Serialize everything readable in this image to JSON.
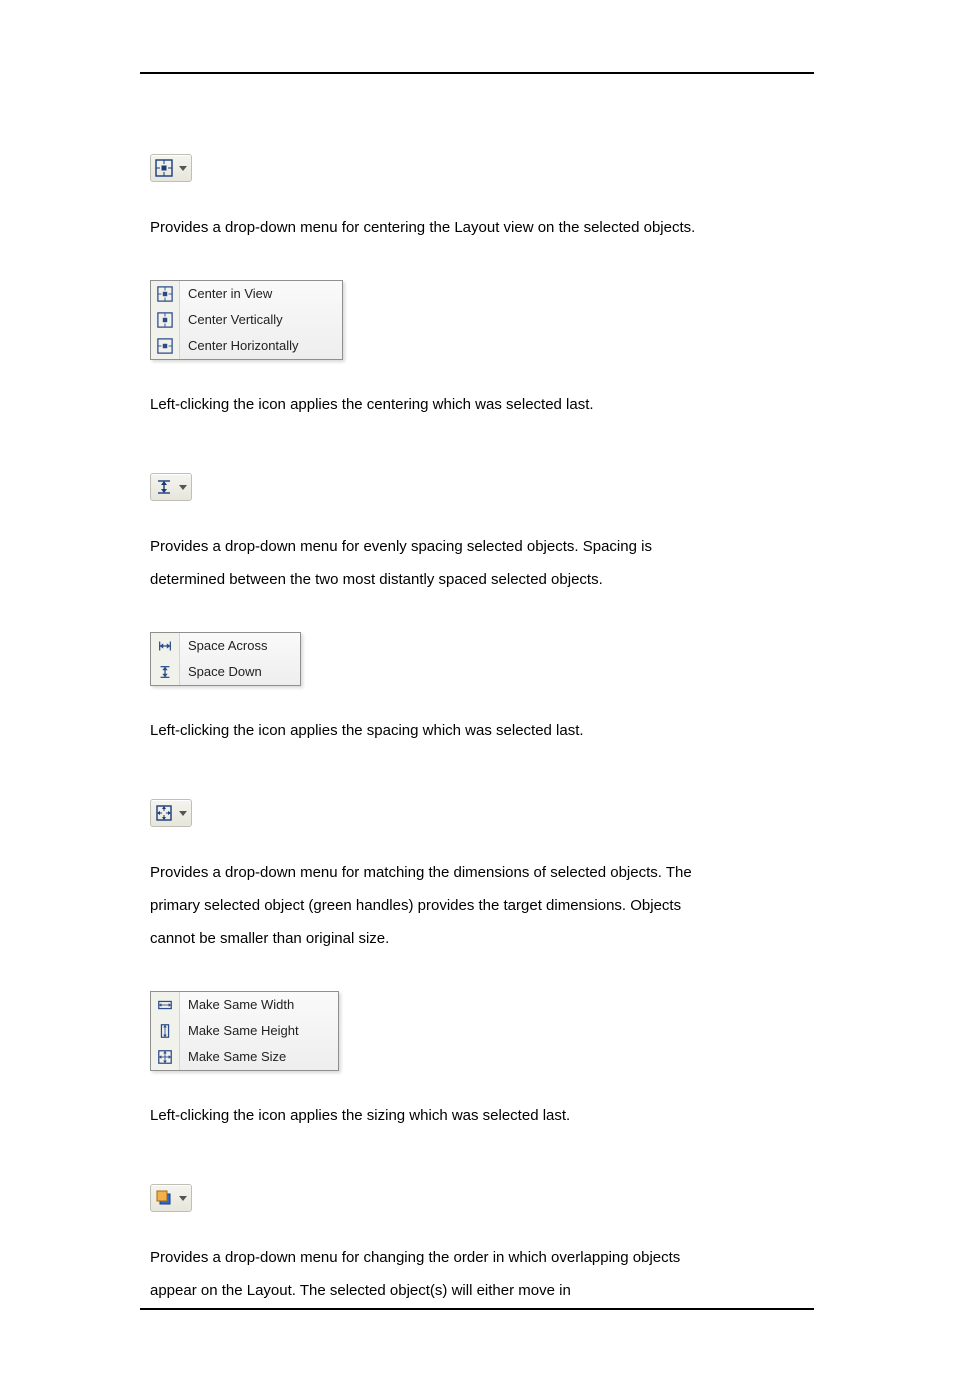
{
  "sections": [
    {
      "para1": "Provides a drop-down menu for centering the Layout view on the selected objects.",
      "para2": "Left-clicking the icon applies the centering which was selected last.",
      "menu": [
        {
          "label": "Center in View"
        },
        {
          "label": "Center Vertically"
        },
        {
          "label": "Center Horizontally"
        }
      ]
    },
    {
      "para1": "Provides a drop-down menu for evenly spacing selected objects. Spacing is determined between the two most distantly spaced selected objects.",
      "para2": "Left-clicking the icon applies the spacing which was selected last.",
      "menu": [
        {
          "label": "Space Across"
        },
        {
          "label": "Space Down"
        }
      ]
    },
    {
      "para1": "Provides a drop-down menu for matching the dimensions of selected objects. The primary selected object (green handles) provides the target dimensions. Objects cannot be smaller than original size.",
      "para2": "Left-clicking the icon applies the sizing which was selected last.",
      "menu": [
        {
          "label": "Make Same Width"
        },
        {
          "label": "Make Same Height"
        },
        {
          "label": "Make Same Size"
        }
      ]
    },
    {
      "para1": "Provides a drop-down menu for changing the order in which overlapping objects appear on the Layout. The selected object(s) will either move in",
      "para2": ""
    }
  ]
}
